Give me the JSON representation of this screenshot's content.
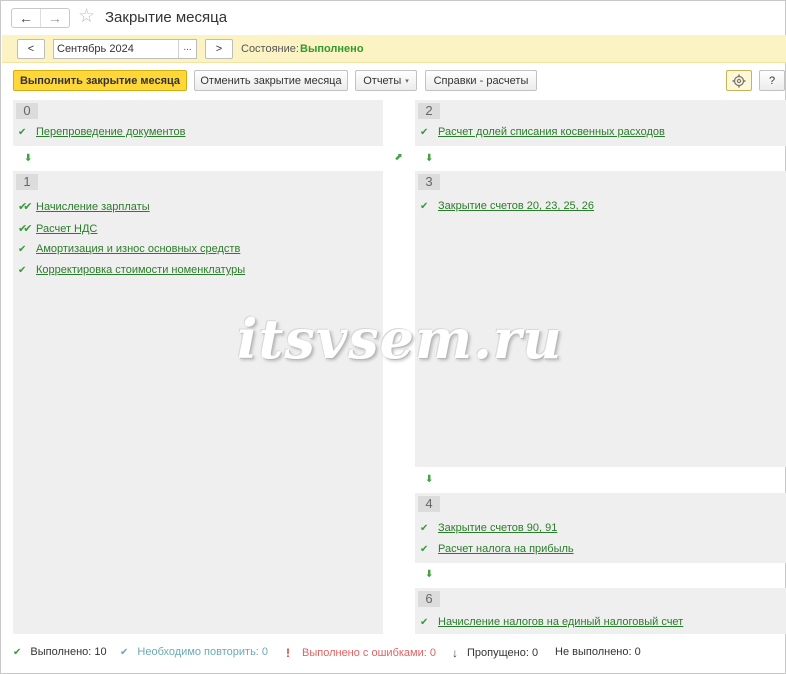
{
  "window": {
    "title": "Закрытие месяца",
    "back_icon": "back-arrow-icon",
    "forward_icon": "forward-arrow-icon",
    "favorite_icon": "star-icon"
  },
  "period": {
    "prev_label": "<",
    "next_label": ">",
    "value": "Сентябрь 2024",
    "select_label": "...",
    "state_label": "Состояние:",
    "state_value": "Выполнено"
  },
  "toolbar": {
    "run_label": "Выполнить закрытие месяца",
    "cancel_label": "Отменить закрытие месяца",
    "reports_label": "Отчеты",
    "references_label": "Справки - расчеты",
    "settings_icon": "gear-icon",
    "help_label": "?",
    "caret": "▾"
  },
  "stages": [
    {
      "number": "0",
      "operations": [
        {
          "label": "Перепроведение документов",
          "status": "done"
        }
      ]
    },
    {
      "number": "1",
      "operations": [
        {
          "label": "Начисление зарплаты",
          "status": "done-with-sub"
        },
        {
          "label": "Расчет НДС",
          "status": "done-with-sub"
        },
        {
          "label": "Амортизация и износ основных средств",
          "status": "done"
        },
        {
          "label": "Корректировка стоимости номенклатуры",
          "status": "done"
        }
      ]
    },
    {
      "number": "2",
      "operations": [
        {
          "label": "Расчет долей списания косвенных расходов",
          "status": "done"
        }
      ]
    },
    {
      "number": "3",
      "operations": [
        {
          "label": "Закрытие счетов 20, 23, 25, 26",
          "status": "done"
        }
      ]
    },
    {
      "number": "4",
      "operations": [
        {
          "label": "Закрытие счетов 90, 91",
          "status": "done"
        },
        {
          "label": "Расчет налога на прибыль",
          "status": "done"
        }
      ]
    },
    {
      "number": "6",
      "operations": [
        {
          "label": "Начисление налогов на единый налоговый счет",
          "status": "done"
        }
      ]
    }
  ],
  "watermark": "itsvsem.ru",
  "status_bar": {
    "done": "Выполнено: 10",
    "repeat": "Необходимо повторить: 0",
    "errors": "Выполнено с ошибками: 0",
    "skipped": "Пропущено: 0",
    "not_done": "Не выполнено: 0"
  },
  "colors": {
    "accent_yellow": "#ffd738",
    "period_bg": "#fbf3c4",
    "success_green": "#339a2c",
    "link_green": "#2a7d2a",
    "error_red": "#e06262",
    "repeat_teal": "#6aaab5"
  }
}
